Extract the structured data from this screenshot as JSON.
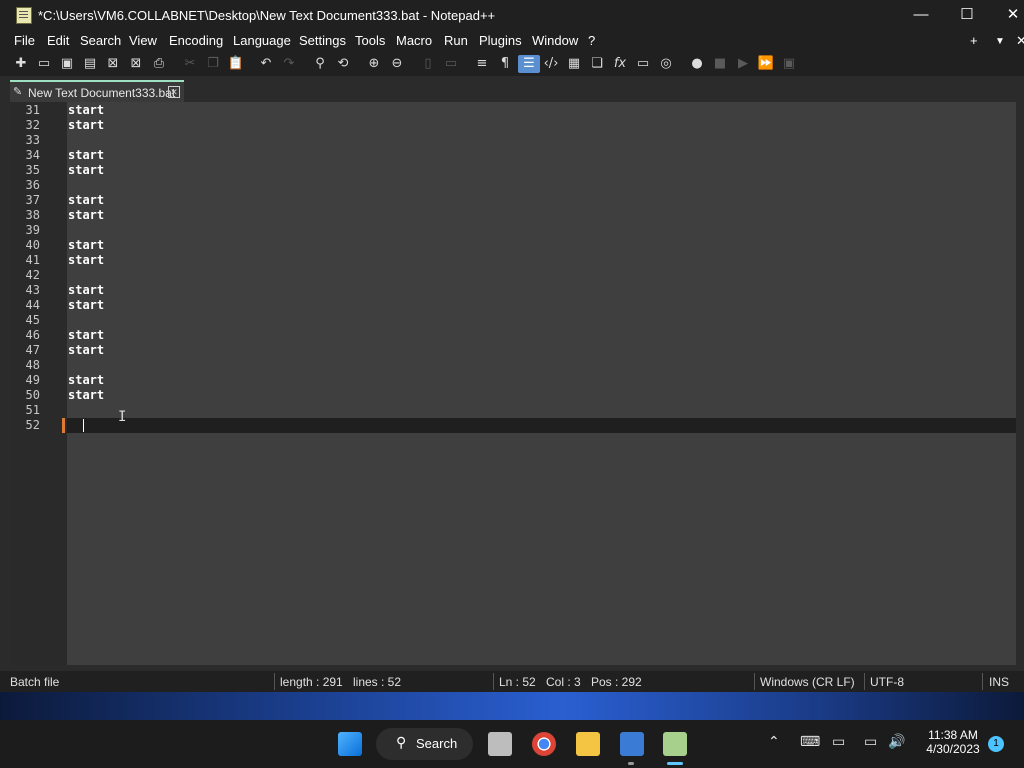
{
  "window": {
    "title": "*C:\\Users\\VM6.COLLABNET\\Desktop\\New Text Document333.bat - Notepad++",
    "min": "—",
    "max": "☐",
    "close": "✕"
  },
  "menu": [
    "File",
    "Edit",
    "Search",
    "View",
    "Encoding",
    "Language",
    "Settings",
    "Tools",
    "Macro",
    "Run",
    "Plugins",
    "Window",
    "?"
  ],
  "menu_right": {
    "add": "+",
    "dropdown": "▼",
    "close": "✕"
  },
  "tab": {
    "label": "New Text Document333.bat",
    "close": "✕"
  },
  "editor": {
    "lines": [
      {
        "num": "31",
        "text": "start"
      },
      {
        "num": "32",
        "text": "start"
      },
      {
        "num": "33",
        "text": ""
      },
      {
        "num": "34",
        "text": "start"
      },
      {
        "num": "35",
        "text": "start"
      },
      {
        "num": "36",
        "text": ""
      },
      {
        "num": "37",
        "text": "start"
      },
      {
        "num": "38",
        "text": "start"
      },
      {
        "num": "39",
        "text": ""
      },
      {
        "num": "40",
        "text": "start"
      },
      {
        "num": "41",
        "text": "start"
      },
      {
        "num": "42",
        "text": ""
      },
      {
        "num": "43",
        "text": "start"
      },
      {
        "num": "44",
        "text": "start"
      },
      {
        "num": "45",
        "text": ""
      },
      {
        "num": "46",
        "text": "start"
      },
      {
        "num": "47",
        "text": "start"
      },
      {
        "num": "48",
        "text": ""
      },
      {
        "num": "49",
        "text": "start"
      },
      {
        "num": "50",
        "text": "start"
      },
      {
        "num": "51",
        "text": ""
      },
      {
        "num": "52",
        "text": ""
      }
    ]
  },
  "status": {
    "filetype": "Batch file",
    "length": "length : 291",
    "lines": "lines : 52",
    "ln": "Ln : 52",
    "col": "Col : 3",
    "pos": "Pos : 292",
    "eol": "Windows (CR LF)",
    "encoding": "UTF-8",
    "mode": "INS"
  },
  "taskbar": {
    "search_label": "Search",
    "time": "11:38 AM",
    "date": "4/30/2023",
    "notification_count": "1"
  }
}
